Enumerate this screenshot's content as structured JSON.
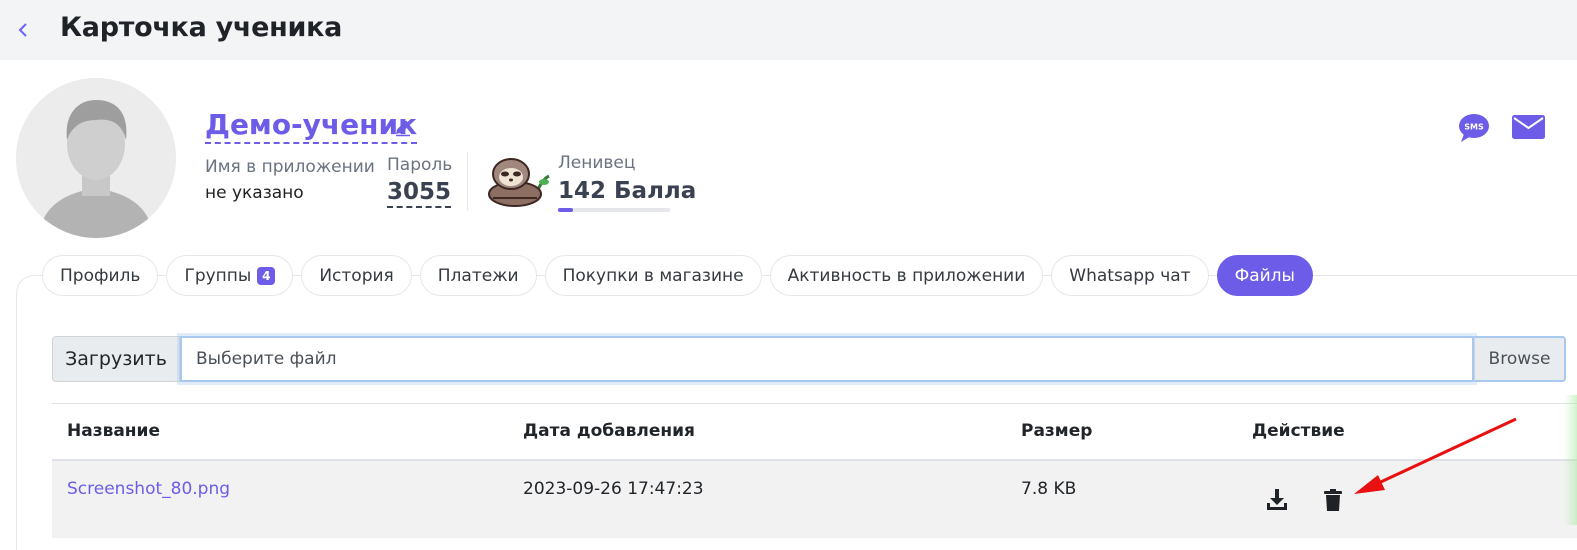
{
  "header": {
    "title": "Карточка ученика",
    "back_icon": "chevron-left-icon"
  },
  "student": {
    "name": "Демо-ученик",
    "app_name_label": "Имя в приложении",
    "app_name_value": "не указано",
    "password_label": "Пароль",
    "password_value": "3055",
    "level_label": "Ленивец",
    "points_text": "142 Балла",
    "level_progress_fraction": 0.13
  },
  "contacts": {
    "sms_icon_text": "SMS"
  },
  "tabs": [
    {
      "label": "Профиль"
    },
    {
      "label": "Группы",
      "badge": "4"
    },
    {
      "label": "История"
    },
    {
      "label": "Платежи"
    },
    {
      "label": "Покупки в магазине"
    },
    {
      "label": "Активность в приложении"
    },
    {
      "label": "Whatsapp чат"
    },
    {
      "label": "Файлы",
      "active": true
    }
  ],
  "upload": {
    "label": "Загрузить",
    "placeholder": "Выберите файл",
    "browse_label": "Browse"
  },
  "files_table": {
    "columns": [
      "Название",
      "Дата добавления",
      "Размер",
      "Действие"
    ],
    "rows": [
      {
        "name": "Screenshot_80.png",
        "date": "2023-09-26 17:47:23",
        "size": "7.8 KB"
      }
    ]
  },
  "colors": {
    "accent": "#6c5ce7",
    "arrow": "#e81010",
    "header_bg": "#f3f4f6"
  }
}
